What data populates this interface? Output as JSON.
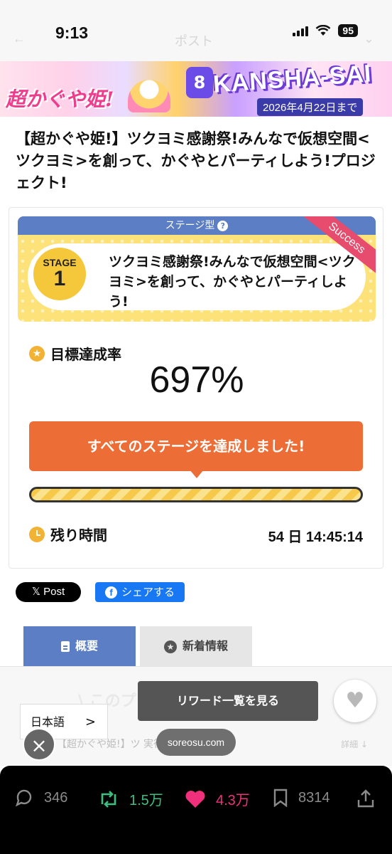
{
  "status_bar": {
    "time": "9:13",
    "battery": "95"
  },
  "ghost_nav": {
    "back": "←",
    "title": "ポスト",
    "chevron": "⌄"
  },
  "banner": {
    "logo": "超かぐや姫!",
    "kansha": "KANSHA-SAI",
    "badge": "8",
    "deadline": "2026年4月22日まで"
  },
  "project": {
    "title": "【超かぐや姫!】ツクヨミ感謝祭!みんなで仮想空間<ツクヨミ>を創って、かぐやとパーティしよう!プロジェクト!"
  },
  "stage": {
    "type_label": "ステージ型",
    "help_icon": "?",
    "badge_label": "STAGE",
    "badge_number": "1",
    "name": "ツクヨミ感謝祭!みんなで仮想空間<ツクヨミ>を創って、かぐやとパーティしよう!",
    "status_ribbon": "Success"
  },
  "goal": {
    "label": "目標達成率",
    "rate": "697%",
    "achieved_message": "すべてのステージを達成しました!",
    "progress_fraction": 1.0
  },
  "remaining": {
    "label": "残り時間",
    "value": "54 日  14:45:14"
  },
  "share": {
    "x_post": "𝕏 Post",
    "facebook": "シェアする",
    "facebook_icon": "f"
  },
  "tabs": [
    {
      "label": "概要"
    },
    {
      "label": "新着情報"
    }
  ],
  "sticky": {
    "faded_heading": "\\ このプ",
    "faded_org": "【超かぐや姫!】ツ         実行委員会",
    "faded_detail": "詳細 ↓",
    "reward_button": "リワード一覧を見る",
    "heart": "♥",
    "language": "日本語",
    "language_chevron": ">",
    "close": "×",
    "domain": "soreosu.com"
  },
  "actions": {
    "replies": "346",
    "retweets": "1.5万",
    "likes": "4.3万",
    "bookmarks": "8314"
  },
  "colors": {
    "stage_blue": "#5b7ec5",
    "stage_yellow": "#fde27a",
    "success_red": "#e74b6d",
    "achieved_orange": "#ec6d35",
    "retweet_green": "#3cbf80",
    "like_pink": "#f0307a"
  }
}
